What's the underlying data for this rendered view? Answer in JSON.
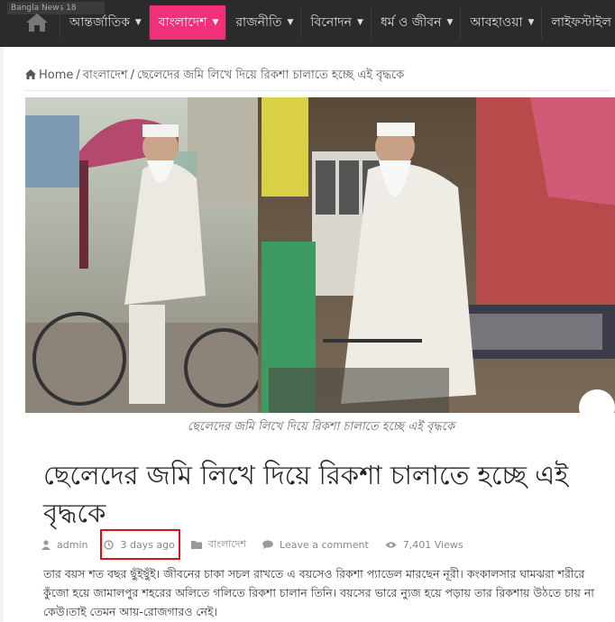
{
  "header": {
    "overlay_text": "Bangla News 18",
    "nav": [
      {
        "label": "আন্তর্জাতিক",
        "active": false
      },
      {
        "label": "বাংলাদেশ",
        "active": true
      },
      {
        "label": "রাজনীতি",
        "active": false
      },
      {
        "label": "বিনোদন",
        "active": false
      },
      {
        "label": "ধর্ম ও জীবন",
        "active": false
      },
      {
        "label": "আবহাওয়া",
        "active": false
      },
      {
        "label": "লাইফস্টাইল",
        "active": false
      }
    ]
  },
  "breadcrumb": {
    "home": "Home",
    "category": "বাংলাদেশ",
    "current": "ছেলেদের জমি লিখে দিয়ে রিকশা চালাতে হচ্ছে এই বৃদ্ধকে"
  },
  "article": {
    "caption": "ছেলেদের জমি লিখে দিয়ে রিকশা চালাতে হচ্ছে এই বৃদ্ধকে",
    "title": "ছেলেদের জমি লিখে দিয়ে রিকশা চালাতে হচ্ছে এই বৃদ্ধকে",
    "meta": {
      "author": "admin",
      "date": "3 days ago",
      "category": "বাংলাদেশ",
      "comment": "Leave a comment",
      "views": "7,401 Views"
    },
    "body": "তার বয়স শত বছর ছুঁইছুঁই। জীবনের চাকা সচল রাখতে এ বয়সেও রিকশা প্যাডেল মারছেন নূরী। কংকালসার ঘামঝরা শরীরে কুঁজো হয়ে জামালপুর শহরের অলিতে গলিতে রিকশা চালান তিনি। বয়সের ভারে ন্যুজ হয়ে পড়ায় তার রিকশায় উঠতে চায় না কেউ।তাই তেমন আয়-রোজগারও নেই।"
  },
  "colors": {
    "nav_bg": "#2b2b2b",
    "accent": "#f0317a",
    "highlight": "#dd1111"
  }
}
